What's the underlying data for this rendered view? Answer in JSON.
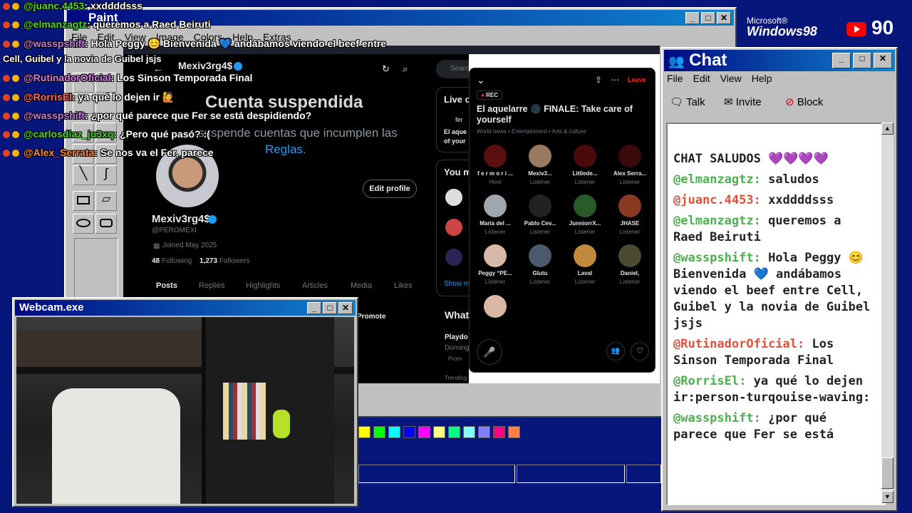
{
  "brand": {
    "microsoft": "Microsoft®",
    "windows": "Windows98",
    "viewer_count": "90"
  },
  "overlay_chat": [
    {
      "user": "@juanc.4453",
      "text": ": xxddddsss",
      "color": "#55d23c"
    },
    {
      "user": "@elmanzagtz",
      "text": ": queremos a Raed Beiruti",
      "color": "#55d23c"
    },
    {
      "user": "@wasspshift",
      "text": ": Hola Peggy 😊 Bienvenida 💙 andábamos viendo el beef entre",
      "color": "#c27ae0"
    },
    {
      "user": "",
      "text": "Cell, Guibel y la novia de Guibel jsjs",
      "color": "#fff"
    },
    {
      "user": "@RutinadorOficial",
      "text": ": Los Sinson Temporada Final",
      "color": "#d978f0"
    },
    {
      "user": "@RorrisEl",
      "text": ": ya qué lo dejen ir 🙋",
      "color": "#ff6a6a"
    },
    {
      "user": "@wasspshift",
      "text": ": ¿por qué parece que Fer se está despidiendo?",
      "color": "#c27ae0"
    },
    {
      "user": "@carlosdiaz_ju3xq",
      "text": ": ¿Pero qué pasó? :(",
      "color": "#55d23c"
    },
    {
      "user": "@Alex_Serrata",
      "text": ": Se nos va el Fer, parece",
      "color": "#ff8a3a"
    }
  ],
  "paint": {
    "title": "Paint",
    "menu": [
      "File",
      "Edit",
      "View",
      "Image",
      "Colors",
      "Help",
      "Extras"
    ],
    "palette": [
      "#ffff00",
      "#00ff00",
      "#00ffff",
      "#0000ff",
      "#ff00ff",
      "#ffff80",
      "#00ff80",
      "#80ffff",
      "#8080ff",
      "#ff0080",
      "#ff8040"
    ]
  },
  "twitter": {
    "header_name": "Mexiv3rg4$",
    "suspended_title": "Cuenta suspendida",
    "suspended_line1": "suspende cuentas que incumplen las",
    "suspended_link": "Reglas.",
    "edit_profile": "Edit profile",
    "display_name": "Mexiv3rg4$",
    "handle": "@PEROMEXI",
    "joined": "Joined May 2025",
    "following_count": "48",
    "following_label": "Following",
    "followers_count": "1,273",
    "followers_label": "Followers",
    "tabs": [
      "Posts",
      "Replies",
      "Highlights",
      "Articles",
      "Media",
      "Likes"
    ],
    "promote": "Promote",
    "search": "Search",
    "side_live": "Live o",
    "side_fer": "fer",
    "side_aq": "El aque",
    "side_of": "of your",
    "side_you": "You m",
    "side_show": "Show m",
    "side_what": "What",
    "side_play": "Playdo",
    "side_dom": "Doming",
    "side_prom": "Prom",
    "trending": "Trending in Mexico"
  },
  "spaces": {
    "rec": "REC",
    "leave": "Leave",
    "title": "El aquelarre 🌑 FINALE: Take care of yourself",
    "meta": "World news • Entertainment • Arts & culture",
    "users": [
      {
        "name": "f e r m o r i ...",
        "role": "Host",
        "color": "#5a1010"
      },
      {
        "name": "Mexiv3...",
        "role": "Listener",
        "color": "#9a7a60"
      },
      {
        "name": "Littlede...",
        "role": "Listener",
        "color": "#4a0a0a"
      },
      {
        "name": "Alex Serra...",
        "role": "Listener",
        "color": "#3a0a0a"
      },
      {
        "name": "María del ...",
        "role": "Listener",
        "color": "#a0a6ad"
      },
      {
        "name": "Pablo Cev...",
        "role": "Listener",
        "color": "#222"
      },
      {
        "name": "JunniorrX...",
        "role": "Listener",
        "color": "#2a5a2a"
      },
      {
        "name": "JHASE",
        "role": "Listener",
        "color": "#8a3a20"
      },
      {
        "name": "Peggy “PE...",
        "role": "Listener",
        "color": "#d8b8a8"
      },
      {
        "name": "Glutu",
        "role": "Listener",
        "color": "#4a5a6a"
      },
      {
        "name": "Laval",
        "role": "Listener",
        "color": "#c08a3a"
      },
      {
        "name": "Daniel,",
        "role": "Listener",
        "color": "#4a4a30"
      }
    ]
  },
  "chat": {
    "title": "Chat",
    "menu": [
      "File",
      "Edit",
      "View",
      "Help"
    ],
    "toolbar": [
      "Talk",
      "Invite",
      "Block"
    ],
    "header": "CHAT SALUDOS 💜💜💜💜",
    "messages": [
      {
        "user": "@elmanzagtz:",
        "text": "saludos",
        "color": "#4caf50"
      },
      {
        "user": "@juanc.4453:",
        "text": "xxddddsss",
        "color": "#e0503a"
      },
      {
        "user": "@elmanzagtz:",
        "text": "queremos a Raed Beiruti",
        "color": "#4caf50"
      },
      {
        "user": "@wasspshift:",
        "text": "Hola Peggy 😊 Bienvenida 💙 andábamos viendo el beef entre Cell, Guibel y la novia de Guibel jsjs",
        "color": "#4caf50"
      },
      {
        "user": "@RutinadorOficial:",
        "text": "Los Sinson Temporada Final",
        "color": "#e0503a"
      },
      {
        "user": "@RorrisEl:",
        "text": "ya qué lo dejen ir:person-turqouise-waving:",
        "color": "#4caf50"
      },
      {
        "user": "@wasspshift:",
        "text": "¿por qué parece que Fer se está",
        "color": "#4caf50"
      }
    ]
  },
  "webcam": {
    "title": "Webcam.exe"
  }
}
